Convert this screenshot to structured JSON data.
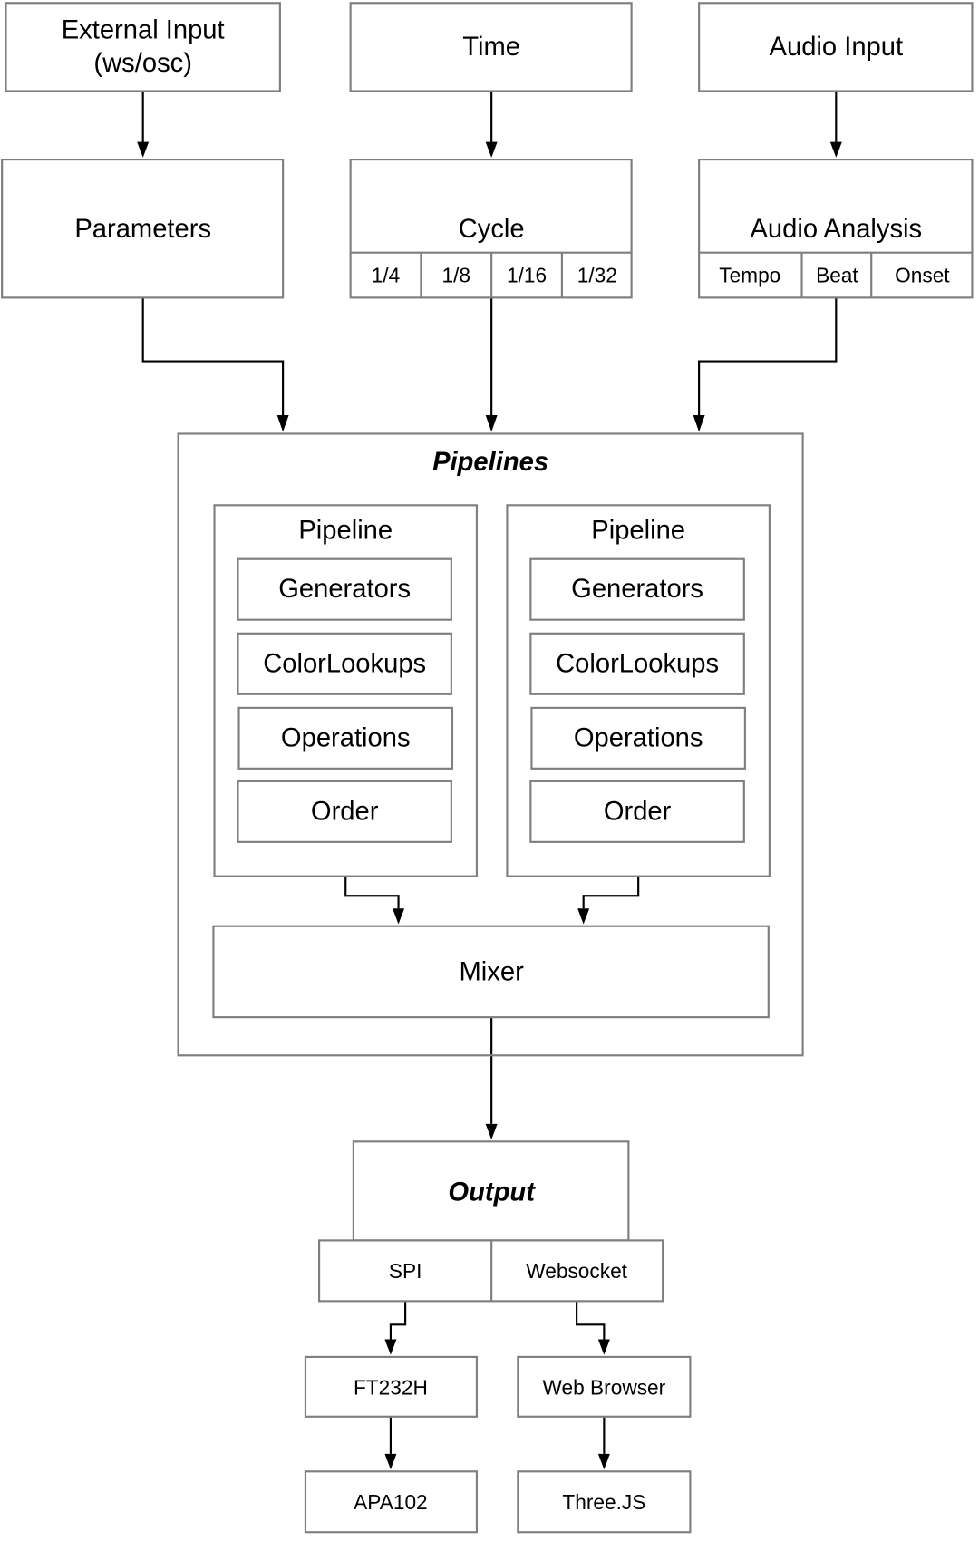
{
  "inputs": {
    "external": {
      "line1": "External Input",
      "line2": "(ws/osc)"
    },
    "time": "Time",
    "audio": "Audio Input"
  },
  "parameters": "Parameters",
  "cycle": {
    "title": "Cycle",
    "divisions": [
      "1/4",
      "1/8",
      "1/16",
      "1/32"
    ]
  },
  "audio_analysis": {
    "title": "Audio Analysis",
    "features": [
      "Tempo",
      "Beat",
      "Onset"
    ]
  },
  "pipelines": {
    "title": "Pipelines",
    "items": [
      {
        "title": "Pipeline",
        "stages": [
          "Generators",
          "ColorLookups",
          "Operations",
          "Order"
        ]
      },
      {
        "title": "Pipeline",
        "stages": [
          "Generators",
          "ColorLookups",
          "Operations",
          "Order"
        ]
      }
    ],
    "mixer": "Mixer"
  },
  "output": {
    "title": "Output",
    "channels": [
      "SPI",
      "Websocket"
    ]
  },
  "devices": [
    {
      "name": "FT232H",
      "target": "APA102"
    },
    {
      "name": "Web Browser",
      "target": "Three.JS"
    }
  ],
  "colors": {
    "border": "#7f7f7f",
    "arrow": "#000000"
  }
}
